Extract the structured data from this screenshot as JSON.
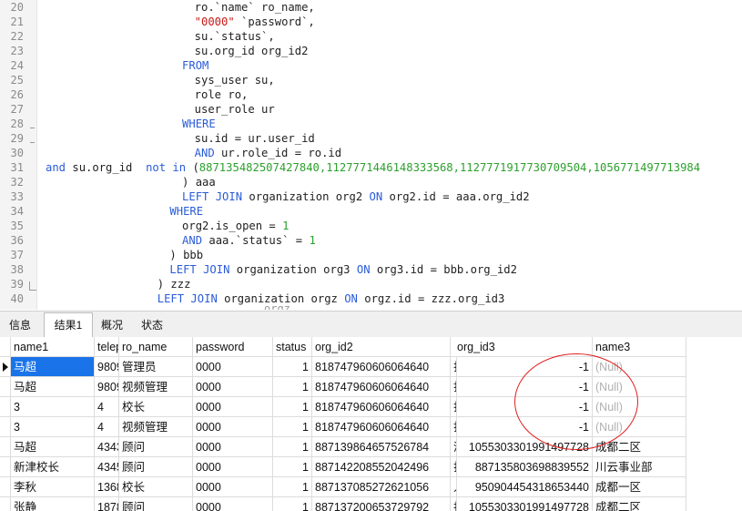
{
  "editor": {
    "lines": [
      {
        "n": "20",
        "indent": 24,
        "tokens": [
          [
            "p",
            "ro.`name` ro_name,"
          ]
        ]
      },
      {
        "n": "21",
        "indent": 24,
        "tokens": [
          [
            "s",
            "\"0000\""
          ],
          [
            "p",
            " `password`,"
          ]
        ]
      },
      {
        "n": "22",
        "indent": 24,
        "tokens": [
          [
            "p",
            "su.`status`,"
          ]
        ]
      },
      {
        "n": "23",
        "indent": 24,
        "tokens": [
          [
            "p",
            "su.org_id org_id2"
          ]
        ]
      },
      {
        "n": "24",
        "indent": 22,
        "tokens": [
          [
            "k",
            "FROM"
          ]
        ]
      },
      {
        "n": "25",
        "indent": 24,
        "tokens": [
          [
            "p",
            "sys_user su,"
          ]
        ]
      },
      {
        "n": "26",
        "indent": 24,
        "tokens": [
          [
            "p",
            "role ro,"
          ]
        ]
      },
      {
        "n": "27",
        "indent": 24,
        "tokens": [
          [
            "p",
            "user_role ur"
          ]
        ]
      },
      {
        "n": "28",
        "indent": 22,
        "tokens": [
          [
            "k",
            "WHERE"
          ]
        ]
      },
      {
        "n": "29",
        "indent": 24,
        "tokens": [
          [
            "p",
            "su.id = ur.user_id"
          ]
        ]
      },
      {
        "n": "30",
        "indent": 24,
        "tokens": [
          [
            "k",
            "AND"
          ],
          [
            "p",
            " ur.role_id = ro.id"
          ]
        ]
      },
      {
        "n": "31",
        "indent": 0,
        "tokens": [
          [
            "k",
            "and"
          ],
          [
            "p",
            " su.org_id  "
          ],
          [
            "k",
            "not in"
          ],
          [
            "p",
            " ("
          ],
          [
            "n",
            "887135482507427840,1127771446148333568,1127771917730709504,1056771497713984"
          ]
        ]
      },
      {
        "n": "32",
        "indent": 22,
        "tokens": [
          [
            "p",
            ") aaa"
          ]
        ]
      },
      {
        "n": "33",
        "indent": 22,
        "tokens": [
          [
            "k",
            "LEFT JOIN"
          ],
          [
            "p",
            " organization org2 "
          ],
          [
            "k",
            "ON"
          ],
          [
            "p",
            " org2.id = aaa.org_id2"
          ]
        ]
      },
      {
        "n": "34",
        "indent": 20,
        "tokens": [
          [
            "k",
            "WHERE"
          ]
        ]
      },
      {
        "n": "35",
        "indent": 22,
        "tokens": [
          [
            "p",
            "org2.is_open = "
          ],
          [
            "n",
            "1"
          ]
        ]
      },
      {
        "n": "36",
        "indent": 22,
        "tokens": [
          [
            "k",
            "AND"
          ],
          [
            "p",
            " aaa.`status` = "
          ],
          [
            "n",
            "1"
          ]
        ]
      },
      {
        "n": "37",
        "indent": 20,
        "tokens": [
          [
            "p",
            ") bbb"
          ]
        ]
      },
      {
        "n": "38",
        "indent": 20,
        "tokens": [
          [
            "k",
            "LEFT JOIN"
          ],
          [
            "p",
            " organization org3 "
          ],
          [
            "k",
            "ON"
          ],
          [
            "p",
            " org3.id = bbb.org_id2"
          ]
        ]
      },
      {
        "n": "39",
        "indent": 18,
        "tokens": [
          [
            "p",
            ") zzz"
          ]
        ]
      },
      {
        "n": "40",
        "indent": 18,
        "tokens": [
          [
            "k",
            "LEFT JOIN"
          ],
          [
            "p",
            " organization orgz "
          ],
          [
            "k",
            "ON"
          ],
          [
            "p",
            " orgz.id = zzz.org_id3"
          ]
        ]
      }
    ],
    "partial_line": "orgz"
  },
  "tabs": [
    {
      "label": "信息",
      "active": false
    },
    {
      "label": "结果1",
      "active": true
    },
    {
      "label": "概况",
      "active": false
    },
    {
      "label": "状态",
      "active": false
    }
  ],
  "grid": {
    "columns": [
      "name1",
      "telep",
      "ro_name",
      "password",
      "status",
      "org_id2",
      "",
      "org_id3",
      "name3"
    ],
    "rows": [
      [
        "马超",
        "9809",
        "管理员",
        "0000",
        "1",
        "818747960606064640",
        "打",
        "-1",
        "(Null)"
      ],
      [
        "马超",
        "9809",
        "视频管理",
        "0000",
        "1",
        "818747960606064640",
        "打",
        "-1",
        "(Null)"
      ],
      [
        "3",
        "4",
        "校长",
        "0000",
        "1",
        "818747960606064640",
        "打",
        "-1",
        "(Null)"
      ],
      [
        "3",
        "4",
        "视频管理",
        "0000",
        "1",
        "818747960606064640",
        "打",
        "-1",
        "(Null)"
      ],
      [
        "马超",
        "4343",
        "顾问",
        "0000",
        "1",
        "887139864657526784",
        "清",
        "1055303301991497728",
        "成都二区"
      ],
      [
        "新津校长",
        "4345",
        "顾问",
        "0000",
        "1",
        "887142208552042496",
        "打",
        "887135803698839552",
        "川云事业部"
      ],
      [
        "李秋",
        "1368",
        "校长",
        "0000",
        "1",
        "887137085272621056",
        "人",
        "950904454318653440",
        "成都一区"
      ],
      [
        "张静",
        "1878",
        "顾问",
        "0000",
        "1",
        "887137200653729792",
        "打",
        "1055303301991497728",
        "成都二区"
      ]
    ],
    "selected_row": 0
  }
}
